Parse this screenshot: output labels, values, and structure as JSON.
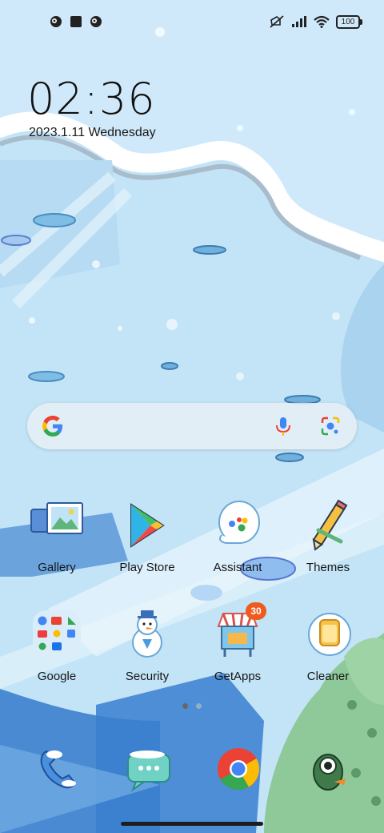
{
  "status_bar": {
    "left_icons": [
      "notification-icon-1",
      "stop-square-icon",
      "notification-icon-2"
    ],
    "right_icons": [
      "mute-icon",
      "signal-icon",
      "wifi-icon"
    ],
    "battery": "100"
  },
  "lockscreen": {
    "time": "02:36",
    "date": "2023.1.11 Wednesday"
  },
  "search_bar": {
    "icons": [
      "google-icon",
      "mic-icon",
      "lens-icon"
    ]
  },
  "apps_row1": [
    {
      "label": "Gallery",
      "icon": "gallery-icon"
    },
    {
      "label": "Play Store",
      "icon": "play-store-icon"
    },
    {
      "label": "Assistant",
      "icon": "assistant-icon"
    },
    {
      "label": "Themes",
      "icon": "themes-icon"
    }
  ],
  "apps_row2": [
    {
      "label": "Google",
      "icon": "google-folder-icon"
    },
    {
      "label": "Security",
      "icon": "security-icon"
    },
    {
      "label": "GetApps",
      "icon": "getapps-icon",
      "badge": "30"
    },
    {
      "label": "Cleaner",
      "icon": "cleaner-icon"
    }
  ],
  "dock": [
    {
      "icon": "phone-icon"
    },
    {
      "icon": "messages-icon"
    },
    {
      "icon": "chrome-icon"
    },
    {
      "icon": "camera-icon"
    }
  ],
  "page_indicator": {
    "pages": 2,
    "current": 1
  },
  "colors": {
    "badge": "#ee5b1f",
    "sky": "#bfe2f6",
    "snow": "#ffffff"
  }
}
